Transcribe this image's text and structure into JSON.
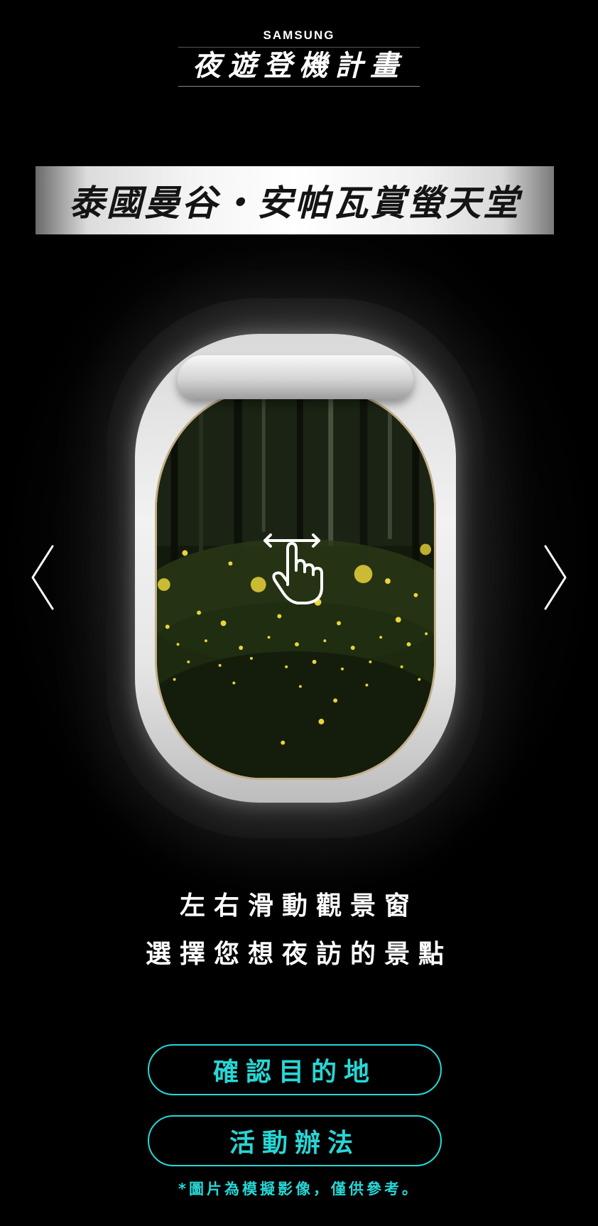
{
  "header": {
    "brand": "SAMSUNG",
    "title": "夜遊登機計畫"
  },
  "banner": {
    "title": "泰國曼谷・安帕瓦賞螢天堂"
  },
  "window": {
    "scene": "fireflies-forest",
    "hint_icon": "swipe-hand-icon"
  },
  "navigation": {
    "prev_icon": "chevron-left-icon",
    "next_icon": "chevron-right-icon"
  },
  "instructions": {
    "line1": "左右滑動觀景窗",
    "line2": "選擇您想夜訪的景點"
  },
  "buttons": {
    "confirm_label": "確認目的地",
    "rules_label": "活動辦法"
  },
  "disclaimer": "*圖片為模擬影像，僅供參考。",
  "colors": {
    "accent": "#27d7d6",
    "background": "#000000",
    "banner_text": "#141414"
  }
}
